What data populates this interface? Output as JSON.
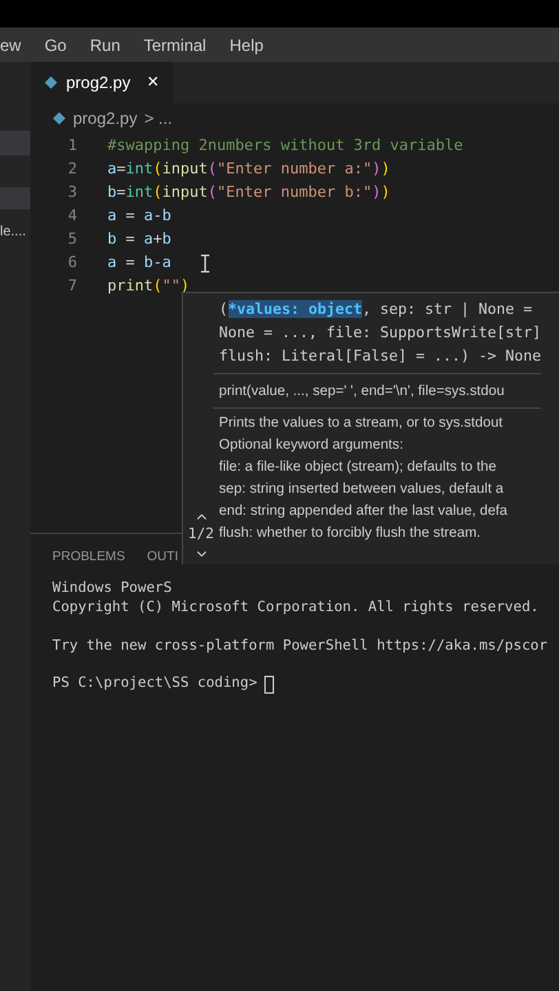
{
  "menu_bar": {
    "items": [
      "ew",
      "Go",
      "Run",
      "Terminal",
      "Help"
    ]
  },
  "sidebar": {
    "items": [
      {
        "label": "le....",
        "selected": false
      }
    ]
  },
  "tabs": [
    {
      "label": "prog2.py",
      "selected": true,
      "close": "✕"
    }
  ],
  "breadcrumb": {
    "file": "prog2.py",
    "rest": "> ..."
  },
  "code_lines": [
    {
      "number": "1",
      "tokens": [
        {
          "text": "#swapping 2numbers without 3rd variable",
          "kind": "comment"
        }
      ]
    },
    {
      "number": "2",
      "tokens": [
        {
          "text": "a",
          "kind": "var"
        },
        {
          "text": "=",
          "kind": "op"
        },
        {
          "text": "int",
          "kind": "builtin"
        },
        {
          "text": "(",
          "kind": "paren"
        },
        {
          "text": "input",
          "kind": "func"
        },
        {
          "text": "(",
          "kind": "paren2"
        },
        {
          "text": "\"Enter number a:\"",
          "kind": "string"
        },
        {
          "text": ")",
          "kind": "paren2"
        },
        {
          "text": ")",
          "kind": "paren"
        }
      ]
    },
    {
      "number": "3",
      "tokens": [
        {
          "text": "b",
          "kind": "var"
        },
        {
          "text": "=",
          "kind": "op"
        },
        {
          "text": "int",
          "kind": "builtin"
        },
        {
          "text": "(",
          "kind": "paren"
        },
        {
          "text": "input",
          "kind": "func"
        },
        {
          "text": "(",
          "kind": "paren2"
        },
        {
          "text": "\"Enter number b:\"",
          "kind": "string"
        },
        {
          "text": ")",
          "kind": "paren2"
        },
        {
          "text": ")",
          "kind": "paren"
        }
      ]
    },
    {
      "number": "4",
      "tokens": [
        {
          "text": "a",
          "kind": "var"
        },
        {
          "text": " = ",
          "kind": "op"
        },
        {
          "text": "a",
          "kind": "var"
        },
        {
          "text": "-",
          "kind": "op"
        },
        {
          "text": "b",
          "kind": "var"
        }
      ]
    },
    {
      "number": "5",
      "tokens": [
        {
          "text": "b",
          "kind": "var"
        },
        {
          "text": " = ",
          "kind": "op"
        },
        {
          "text": "a",
          "kind": "var"
        },
        {
          "text": "+",
          "kind": "op"
        },
        {
          "text": "b",
          "kind": "var"
        }
      ]
    },
    {
      "number": "6",
      "tokens": [
        {
          "text": "a",
          "kind": "var"
        },
        {
          "text": " = ",
          "kind": "op"
        },
        {
          "text": "b",
          "kind": "var"
        },
        {
          "text": "-",
          "kind": "op"
        },
        {
          "text": "a",
          "kind": "var"
        }
      ],
      "mouse_cursor": true
    },
    {
      "number": "7",
      "tokens": [
        {
          "text": "print",
          "kind": "func"
        },
        {
          "text": "(",
          "kind": "paren"
        },
        {
          "text": "\"\"",
          "kind": "string"
        },
        {
          "text": ")",
          "kind": "paren"
        }
      ],
      "mouse_cursor": false
    }
  ],
  "signature_help": {
    "signature_lines": [
      [
        {
          "text": "(",
          "active": false
        },
        {
          "text": "*values: object",
          "active": true
        },
        {
          "text": ", sep: str | None =",
          "active": false
        }
      ],
      [
        {
          "text": "None = ..., file: SupportsWrite[str]",
          "active": false
        }
      ],
      [
        {
          "text": "flush: Literal[False] = ...) -> None",
          "active": false
        }
      ]
    ],
    "usage": "print(value, ..., sep=' ', end='\\n', file=sys.stdou",
    "doc_lines": [
      "Prints the values to a stream, or to sys.stdout",
      "Optional keyword arguments:",
      "file: a file-like object (stream); defaults to the",
      "sep: string inserted between values, default a",
      "end: string appended after the last value, defa",
      "flush: whether to forcibly flush the stream."
    ],
    "pager": "1/2"
  },
  "panel": {
    "tabs": [
      {
        "label": "PROBLEMS",
        "selected": false
      },
      {
        "label": "OUTI",
        "selected": false
      }
    ],
    "terminal_blocks": [
      [
        "Windows PowerS",
        "Copyright (C) Microsoft Corporation. All rights reserved."
      ],
      [
        "Try the new cross-platform PowerShell https://aka.ms/pscor"
      ]
    ],
    "prompt": "PS C:\\project\\SS coding>"
  }
}
